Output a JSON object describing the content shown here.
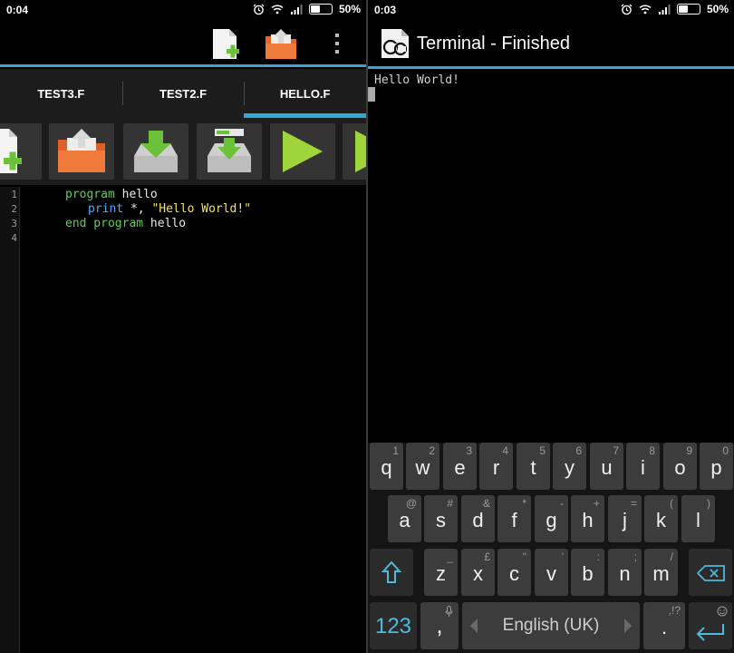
{
  "left": {
    "status": {
      "time": "0:04",
      "battery": "50%"
    },
    "tabs": [
      {
        "label": "TEST3.F",
        "active": false
      },
      {
        "label": "TEST2.F",
        "active": false
      },
      {
        "label": "HELLO.F",
        "active": true
      }
    ],
    "line_numbers": [
      "1",
      "2",
      "3",
      "4"
    ],
    "code": {
      "l1_kw": "program",
      "l1_name": " hello",
      "l2_fn": "print",
      "l2_mid": " *, ",
      "l2_str": "\"Hello World!\"",
      "l3_kw": "end program",
      "l3_name": " hello"
    }
  },
  "right": {
    "status": {
      "time": "0:03",
      "battery": "50%"
    },
    "title": "Terminal - Finished",
    "terminal_output": "Hello World!",
    "keyboard": {
      "row1": [
        {
          "key": "q",
          "hint": "1"
        },
        {
          "key": "w",
          "hint": "2"
        },
        {
          "key": "e",
          "hint": "3"
        },
        {
          "key": "r",
          "hint": "4"
        },
        {
          "key": "t",
          "hint": "5"
        },
        {
          "key": "y",
          "hint": "6"
        },
        {
          "key": "u",
          "hint": "7"
        },
        {
          "key": "i",
          "hint": "8"
        },
        {
          "key": "o",
          "hint": "9"
        },
        {
          "key": "p",
          "hint": "0"
        }
      ],
      "row2": [
        {
          "key": "a",
          "hint": "@"
        },
        {
          "key": "s",
          "hint": "#"
        },
        {
          "key": "d",
          "hint": "&"
        },
        {
          "key": "f",
          "hint": "*"
        },
        {
          "key": "g",
          "hint": "-"
        },
        {
          "key": "h",
          "hint": "+"
        },
        {
          "key": "j",
          "hint": "="
        },
        {
          "key": "k",
          "hint": "("
        },
        {
          "key": "l",
          "hint": ")"
        }
      ],
      "row3": [
        {
          "key": "z",
          "hint": "_"
        },
        {
          "key": "x",
          "hint": "£"
        },
        {
          "key": "c",
          "hint": "\""
        },
        {
          "key": "v",
          "hint": "'"
        },
        {
          "key": "b",
          "hint": ":"
        },
        {
          "key": "n",
          "hint": ";"
        },
        {
          "key": "m",
          "hint": "/"
        }
      ],
      "numbers_label": "123",
      "comma": ",",
      "space_label": "English (UK)",
      "period": ".",
      "period_hint": ",!?"
    }
  },
  "colors": {
    "accent": "#33a8d8",
    "keyword": "#5bd14a",
    "function": "#4fa8ff",
    "string": "#f2e36b"
  }
}
